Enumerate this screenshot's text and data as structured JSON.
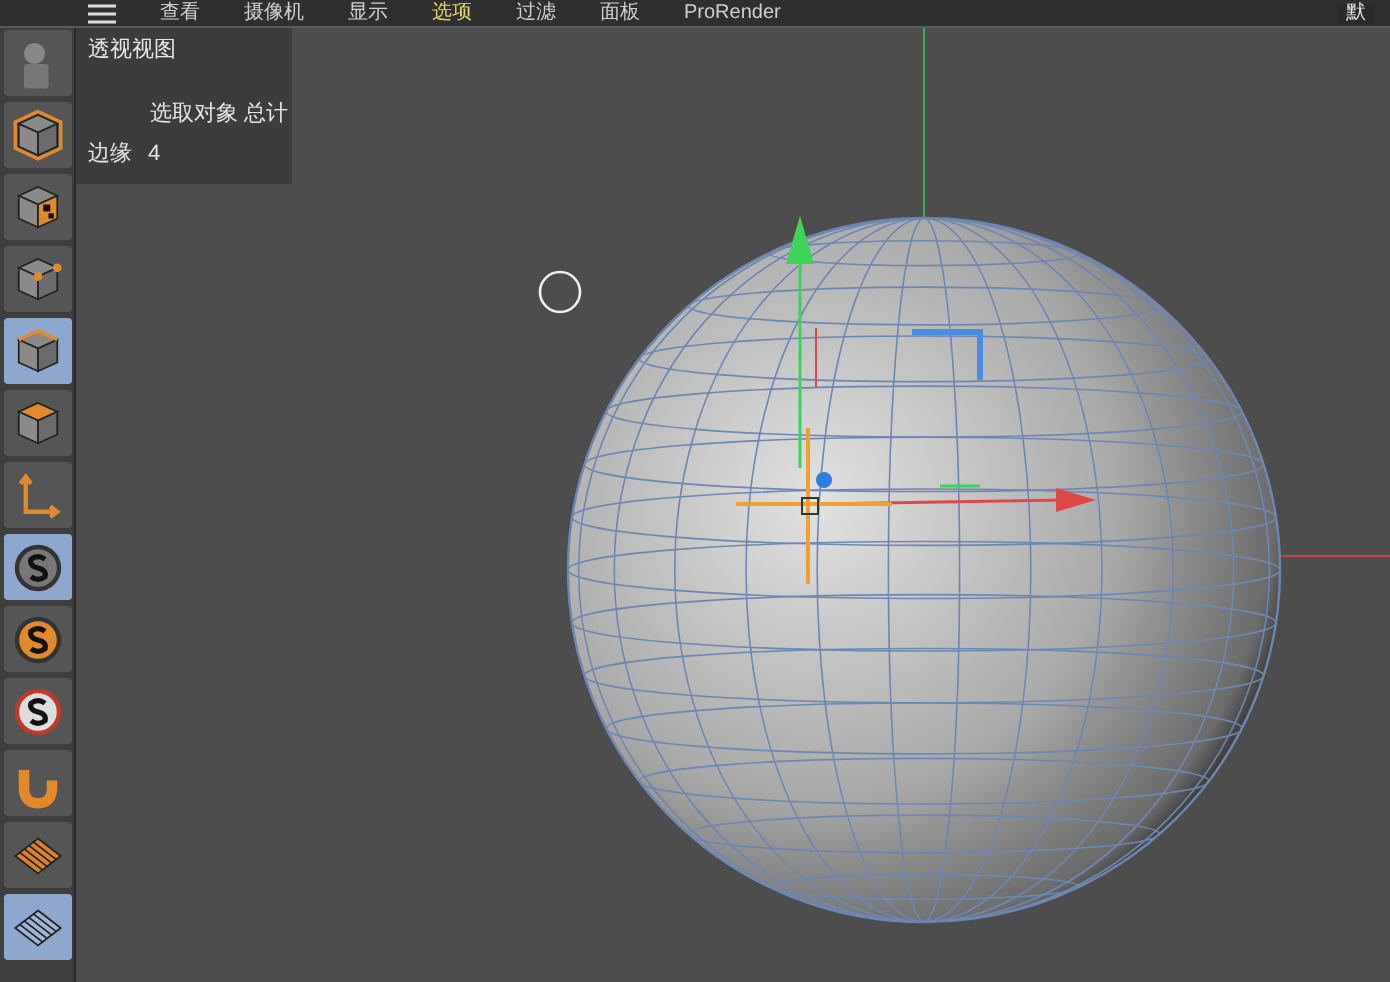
{
  "menu": [
    {
      "label": "查看",
      "selected": false
    },
    {
      "label": "摄像机",
      "selected": false
    },
    {
      "label": "显示",
      "selected": false
    },
    {
      "label": "选项",
      "selected": true
    },
    {
      "label": "过滤",
      "selected": false
    },
    {
      "label": "面板",
      "selected": false
    },
    {
      "label": "ProRender",
      "selected": false
    }
  ],
  "menu_right": "默",
  "tools": [
    {
      "kind": "app",
      "selected": false
    },
    {
      "kind": "cube",
      "selected": false
    },
    {
      "kind": "checker",
      "selected": false
    },
    {
      "kind": "points",
      "selected": false
    },
    {
      "kind": "edges",
      "selected": true
    },
    {
      "kind": "polygons",
      "selected": false
    },
    {
      "kind": "axis",
      "selected": false
    },
    {
      "kind": "snap-gray",
      "selected": true
    },
    {
      "kind": "snap-orange",
      "selected": false
    },
    {
      "kind": "snap-white",
      "selected": false
    },
    {
      "kind": "magnet",
      "selected": false
    },
    {
      "kind": "grid-orange",
      "selected": false
    },
    {
      "kind": "grid-blue",
      "selected": true
    }
  ],
  "viewport": {
    "title": "透视视图",
    "stats_header": "选取对象 总计",
    "stats": [
      {
        "label": "边缘",
        "value": "4"
      }
    ]
  }
}
